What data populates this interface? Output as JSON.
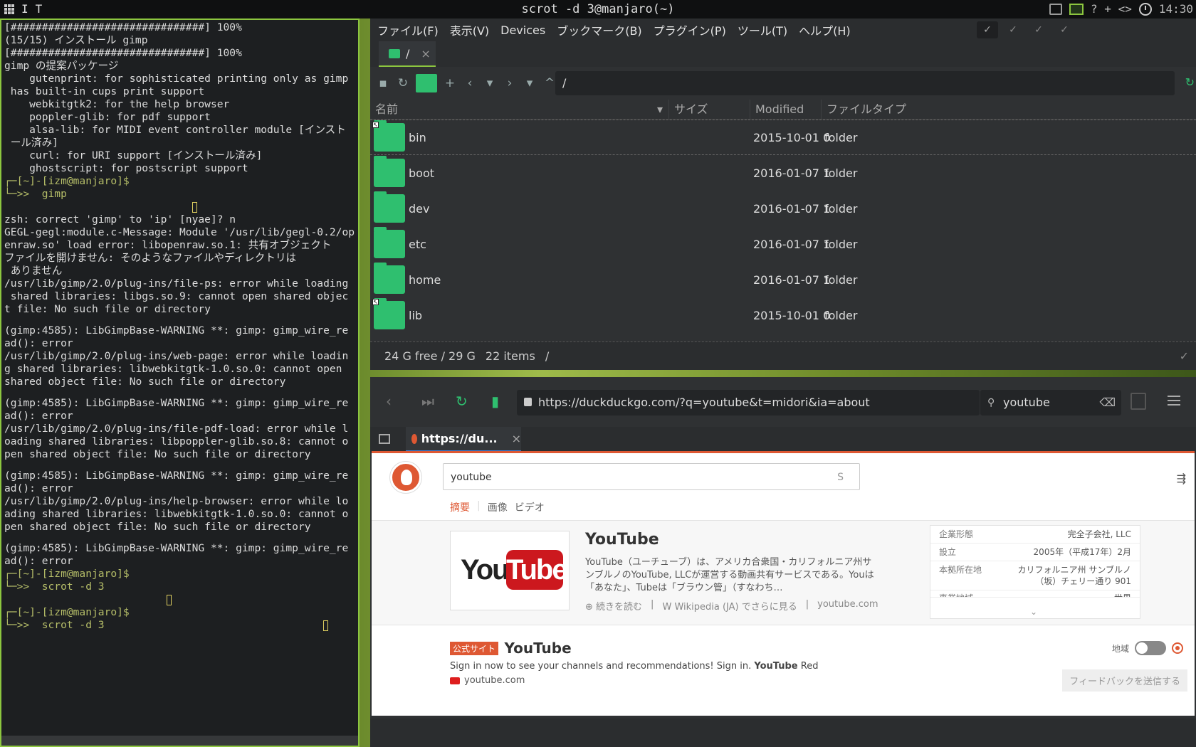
{
  "topbar": {
    "left_labels": [
      "I",
      "T"
    ],
    "title": "scrot -d 3@manjaro(~)",
    "right_symbols": "? + <>",
    "clock": "14:30"
  },
  "terminal": {
    "lines": [
      {
        "t": "[###############################] 100%"
      },
      {
        "t": "(15/15) インストール gimp"
      },
      {
        "t": "[###############################] 100%"
      },
      {
        "t": "gimp の提案パッケージ"
      },
      {
        "t": "    gutenprint: for sophisticated printing only as gimp"
      },
      {
        "t": " has built-in cups print support"
      },
      {
        "t": "    webkitgtk2: for the help browser"
      },
      {
        "t": "    poppler-glib: for pdf support"
      },
      {
        "t": "    alsa-lib: for MIDI event controller module [インスト"
      },
      {
        "t": " ール済み]"
      },
      {
        "t": "    curl: for URI support [インストール済み]"
      },
      {
        "t": "    ghostscript: for postscript support"
      },
      {
        "t": "┌─[~]-[izm@manjaro]$",
        "c": "prompt"
      },
      {
        "t": "└─>>  gimp",
        "c": "prompt"
      },
      {
        "t": "                              ",
        "cursor": true
      },
      {
        "t": "zsh: correct 'gimp' to 'ip' [nyae]? n"
      },
      {
        "t": "GEGL-gegl:module.c-Message: Module '/usr/lib/gegl-0.2/op"
      },
      {
        "t": "enraw.so' load error: libopenraw.so.1: 共有オブジェクト"
      },
      {
        "t": "ファイルを開けません: そのようなファイルやディレクトリは"
      },
      {
        "t": " ありません"
      },
      {
        "t": "/usr/lib/gimp/2.0/plug-ins/file-ps: error while loading"
      },
      {
        "t": " shared libraries: libgs.so.9: cannot open shared objec"
      },
      {
        "t": "t file: No such file or directory"
      },
      {
        "t": "",
        "gap": true
      },
      {
        "t": "(gimp:4585): LibGimpBase-WARNING **: gimp: gimp_wire_re"
      },
      {
        "t": "ad(): error"
      },
      {
        "t": "/usr/lib/gimp/2.0/plug-ins/web-page: error while loadin"
      },
      {
        "t": "g shared libraries: libwebkitgtk-1.0.so.0: cannot open"
      },
      {
        "t": "shared object file: No such file or directory"
      },
      {
        "t": "",
        "gap": true
      },
      {
        "t": "(gimp:4585): LibGimpBase-WARNING **: gimp: gimp_wire_re"
      },
      {
        "t": "ad(): error"
      },
      {
        "t": "/usr/lib/gimp/2.0/plug-ins/file-pdf-load: error while l"
      },
      {
        "t": "oading shared libraries: libpoppler-glib.so.8: cannot o"
      },
      {
        "t": "pen shared object file: No such file or directory"
      },
      {
        "t": "",
        "gap": true
      },
      {
        "t": "(gimp:4585): LibGimpBase-WARNING **: gimp: gimp_wire_re"
      },
      {
        "t": "ad(): error"
      },
      {
        "t": "/usr/lib/gimp/2.0/plug-ins/help-browser: error while lo"
      },
      {
        "t": "ading shared libraries: libwebkitgtk-1.0.so.0: cannot o"
      },
      {
        "t": "pen shared object file: No such file or directory"
      },
      {
        "t": "",
        "gap": true
      },
      {
        "t": "(gimp:4585): LibGimpBase-WARNING **: gimp: gimp_wire_re"
      },
      {
        "t": "ad(): error"
      },
      {
        "t": "┌─[~]-[izm@manjaro]$",
        "c": "prompt"
      },
      {
        "t": "└─>>  scrot -d 3",
        "c": "prompt"
      },
      {
        "t": "                          ",
        "cursor": true
      },
      {
        "t": "┌─[~]-[izm@manjaro]$",
        "c": "prompt"
      },
      {
        "t": "└─>>  scrot -d 3                                   ",
        "c": "prompt",
        "cursor": true
      }
    ]
  },
  "filemanager": {
    "menu": [
      "ファイル(F)",
      "表示(V)",
      "Devices",
      "ブックマーク(B)",
      "プラグイン(P)",
      "ツール(T)",
      "ヘルプ(H)"
    ],
    "tab_label": "/",
    "tab_close": "×",
    "path": "/",
    "columns": [
      "名前",
      "サイズ",
      "Modified",
      "ファイルタイプ"
    ],
    "rows": [
      {
        "name": "bin",
        "modified": "2015-10-01 0",
        "type": "folder",
        "link": true
      },
      {
        "name": "boot",
        "modified": "2016-01-07 1",
        "type": "folder"
      },
      {
        "name": "dev",
        "modified": "2016-01-07 1",
        "type": "folder"
      },
      {
        "name": "etc",
        "modified": "2016-01-07 1",
        "type": "folder"
      },
      {
        "name": "home",
        "modified": "2016-01-07 1",
        "type": "folder"
      },
      {
        "name": "lib",
        "modified": "2015-10-01 0",
        "type": "folder",
        "link": true
      }
    ],
    "status": {
      "free": "24 G free / 29 G",
      "items": "22 items",
      "path": "/"
    }
  },
  "browser": {
    "url": "https://duckduckgo.com/?q=youtube&t=midori&ia=about",
    "search": "youtube",
    "tab_label": "https://du...",
    "tab_close": "×",
    "query": "youtube",
    "query_icon": "S",
    "page_tabs": [
      "摘要",
      "画像",
      "ビデオ"
    ],
    "result": {
      "title": "YouTube",
      "desc": "YouTube（ユーチューブ）は、アメリカ合衆国・カリフォルニア州サンブルノのYouTube, LLCが運営する動画共有サービスである。Youは「あなた」、Tubeは「ブラウン管」（すなわち…",
      "read_more": "続きを読む",
      "wiki": "Wikipedia (JA) でさらに見る",
      "site": "youtube.com",
      "logo_you": "You",
      "logo_tube": "Tube"
    },
    "infobox": [
      {
        "k": "企業形態",
        "v": "完全子会社, LLC"
      },
      {
        "k": "設立",
        "v": "2005年（平成17年）2月"
      },
      {
        "k": "本拠所在地",
        "v": "カリフォルニア州 サンブルノ（坂）チェリー通り 901"
      },
      {
        "k": "事業地域",
        "v": "世界"
      }
    ],
    "result2": {
      "badge": "公式サイト",
      "title": "YouTube",
      "snippet_pre": "Sign in now to see your channels and recommendations! Sign in. ",
      "snippet_bold": "YouTube",
      "snippet_post": " Red",
      "url": "youtube.com"
    },
    "region_label": "地域",
    "feedback": "フィードバックを送信する"
  }
}
